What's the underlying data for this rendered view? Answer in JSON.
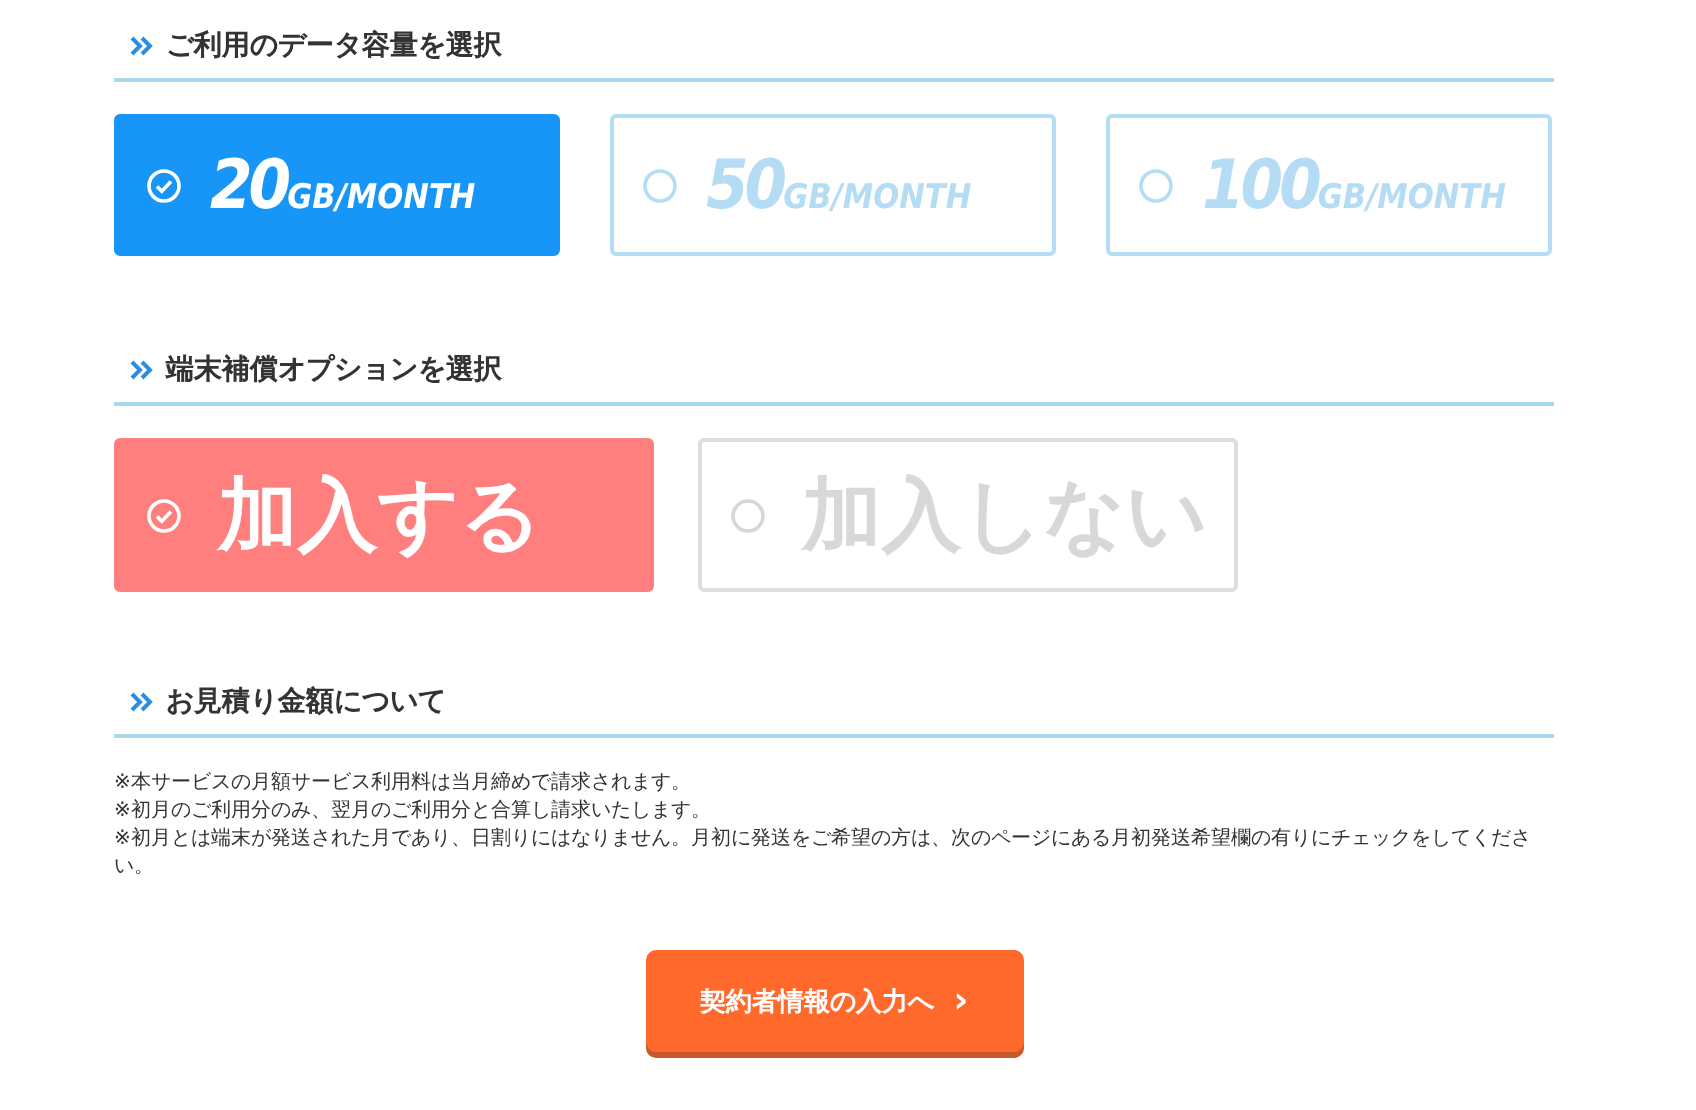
{
  "sections": [
    {
      "heading": "ご利用のデータ容量を選択",
      "kind": "plans",
      "options": [
        {
          "amount": "20",
          "unit": "GB/MONTH",
          "selected": true
        },
        {
          "amount": "50",
          "unit": "GB/MONTH",
          "selected": false
        },
        {
          "amount": "100",
          "unit": "GB/MONTH",
          "selected": false
        }
      ]
    },
    {
      "heading": "端末補償オプションを選択",
      "kind": "insurance",
      "options": [
        {
          "label": "加入する",
          "selected": true
        },
        {
          "label": "加入しない",
          "selected": false
        }
      ]
    },
    {
      "heading": "お見積り金額について",
      "kind": "notes",
      "notes": [
        "※本サービスの月額サービス利用料は当月締めで請求されます。",
        "※初月のご利用分のみ、翌月のご利用分と合算し請求いたします。",
        "※初月とは端末が発送された月であり、日割りにはなりません。月初に発送をご希望の方は、次のページにある月初発送希望欄の有りにチェックをしてください。"
      ]
    }
  ],
  "next_button": {
    "label": "契約者情報の入力へ",
    "icon": "›"
  }
}
